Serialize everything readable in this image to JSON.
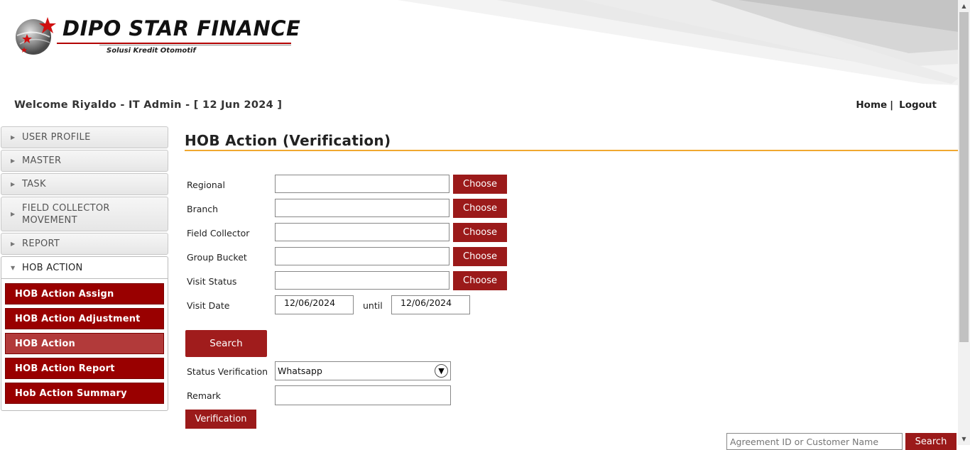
{
  "brand": {
    "name": "DIPO STAR FINANCE",
    "tagline": "Solusi Kredit Otomotif"
  },
  "header": {
    "welcome": "Welcome Riyaldo - IT Admin - [ 12 Jun 2024 ]",
    "home_link": "Home",
    "separator": "|",
    "logout_link": "Logout"
  },
  "sidebar": {
    "items": [
      {
        "label": "USER PROFILE"
      },
      {
        "label": "MASTER"
      },
      {
        "label": "TASK"
      },
      {
        "label": "FIELD COLLECTOR MOVEMENT"
      },
      {
        "label": "REPORT"
      },
      {
        "label": "HOB ACTION"
      }
    ],
    "subitems": [
      {
        "label": "HOB Action Assign"
      },
      {
        "label": "HOB Action Adjustment"
      },
      {
        "label": "HOB Action"
      },
      {
        "label": "HOB Action Report"
      },
      {
        "label": "Hob Action Summary"
      }
    ]
  },
  "main": {
    "title": "HOB Action (Verification)",
    "fields": {
      "regional_label": "Regional",
      "branch_label": "Branch",
      "field_collector_label": "Field Collector",
      "group_bucket_label": "Group Bucket",
      "visit_status_label": "Visit Status",
      "visit_date_label": "Visit Date",
      "choose_label": "Choose",
      "date_from": "12/06/2024",
      "until_label": "until",
      "date_to": "12/06/2024"
    },
    "search_label": "Search",
    "status_verification_label": "Status Verification",
    "status_verification_value": "Whatsapp",
    "remark_label": "Remark",
    "verification_label": "Verification",
    "bottom_search_placeholder": "Agreement ID or Customer Name",
    "bottom_search_label": "Search"
  },
  "colors": {
    "accent": "#9b1a1a",
    "title_rule": "#f0a830"
  }
}
